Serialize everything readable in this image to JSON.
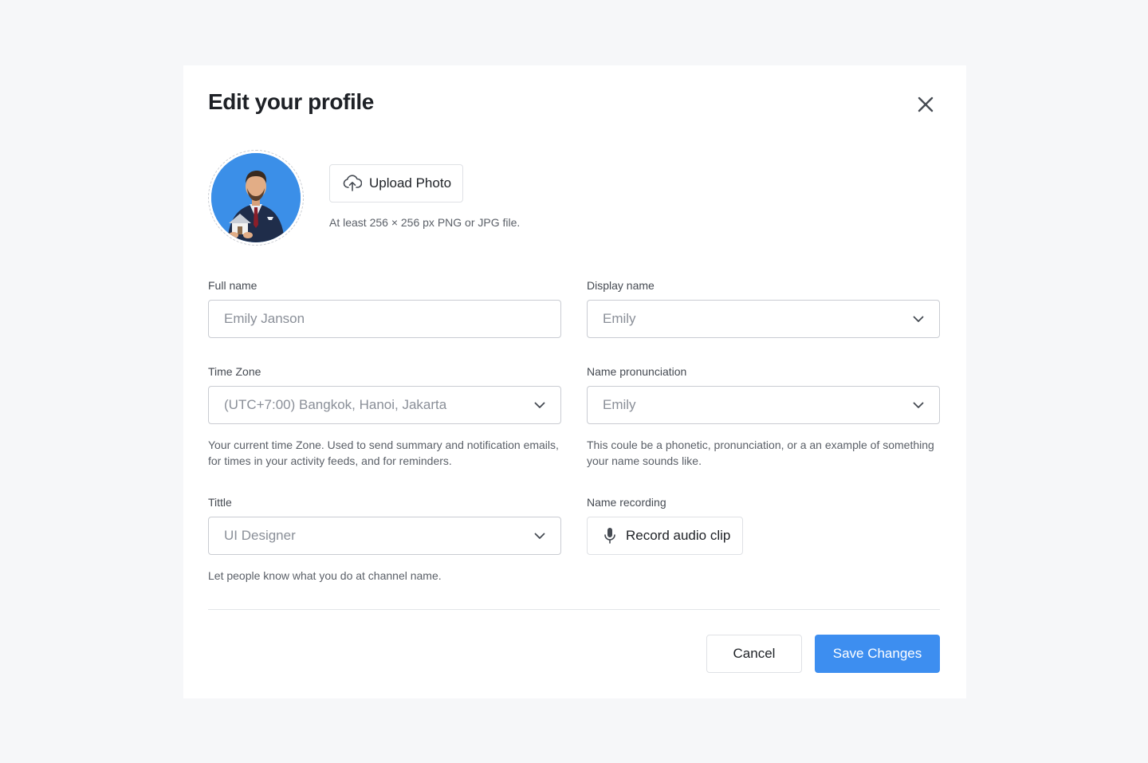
{
  "dialog": {
    "title": "Edit your profile"
  },
  "photo": {
    "upload_label": "Upload Photo",
    "hint": "At least 256 × 256 px PNG or JPG file."
  },
  "fields": {
    "full_name": {
      "label": "Full name",
      "placeholder": "Emily Janson"
    },
    "display_name": {
      "label": "Display name",
      "value": "Emily"
    },
    "time_zone": {
      "label": "Time Zone",
      "value": "(UTC+7:00) Bangkok, Hanoi, Jakarta",
      "help": "Your current time Zone. Used to send summary and notification emails, for times in your activity feeds, and for reminders."
    },
    "name_pronunciation": {
      "label": "Name pronunciation",
      "value": "Emily",
      "help": "This coule be a phonetic, pronunciation, or a an example of something your name sounds like."
    },
    "title": {
      "label": "Tittle",
      "value": "UI Designer",
      "help": "Let people know what you do at channel name."
    },
    "name_recording": {
      "label": "Name recording",
      "button_label": "Record audio clip"
    }
  },
  "actions": {
    "cancel_label": "Cancel",
    "save_label": "Save Changes"
  },
  "icons": {
    "close": "close-icon",
    "upload": "cloud-upload-icon",
    "chevron": "chevron-down-icon",
    "mic": "microphone-icon"
  },
  "colors": {
    "primary": "#3d8ef0",
    "avatar_bg": "#3b8fe8",
    "page_bg": "#f6f7f9"
  }
}
